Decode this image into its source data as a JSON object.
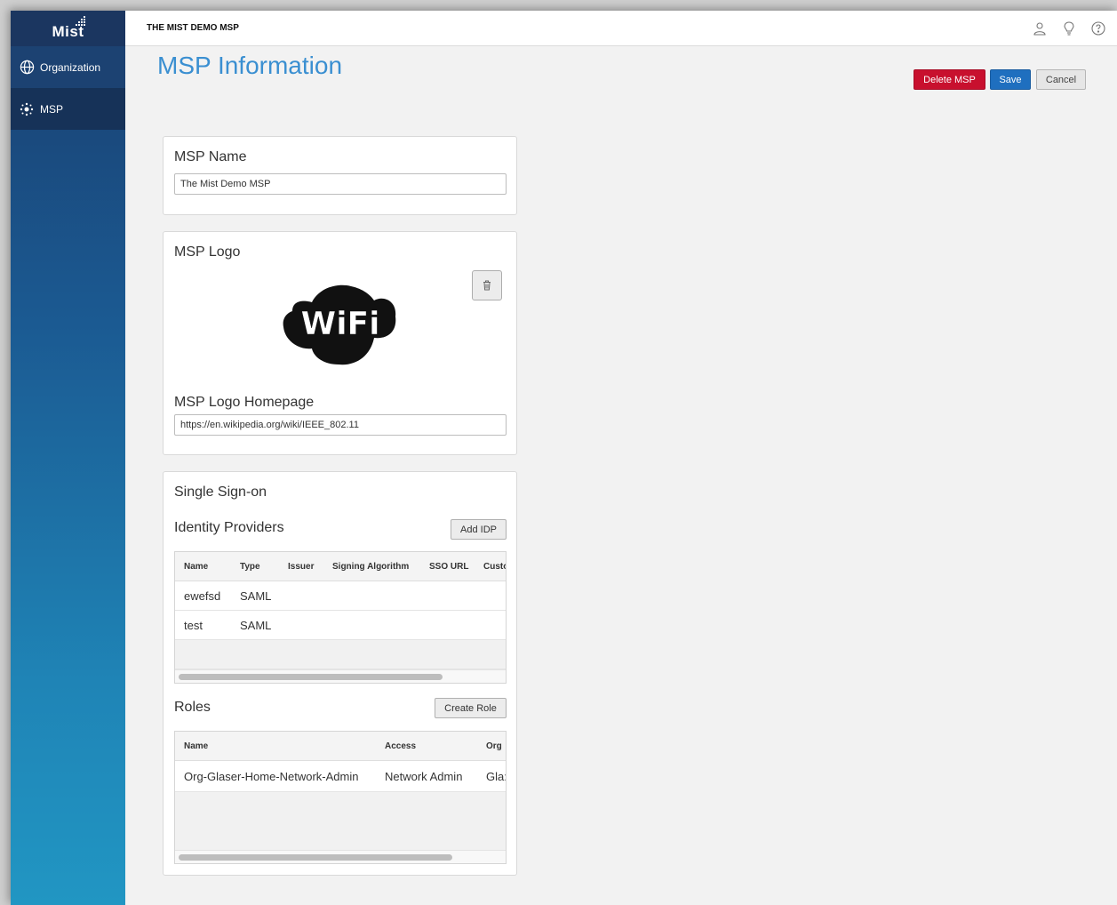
{
  "app": {
    "logo_text": "Mist",
    "msp_name_header": "THE MIST DEMO MSP"
  },
  "sidebar": {
    "items": [
      {
        "label": "Organization",
        "icon": "globe-icon"
      },
      {
        "label": "MSP",
        "icon": "msp-icon"
      }
    ]
  },
  "header_icons": [
    "user-icon",
    "lightbulb-icon",
    "help-icon"
  ],
  "page": {
    "title": "MSP Information",
    "buttons": {
      "delete": "Delete MSP",
      "save": "Save",
      "cancel": "Cancel"
    }
  },
  "msp_name": {
    "heading": "MSP Name",
    "value": "The Mist Demo MSP"
  },
  "msp_logo": {
    "heading": "MSP Logo",
    "logo_text": "WiFi",
    "homepage_heading": "MSP Logo Homepage",
    "homepage_value": "https://en.wikipedia.org/wiki/IEEE_802.11"
  },
  "sso": {
    "heading": "Single Sign-on",
    "idp": {
      "heading": "Identity Providers",
      "add_button": "Add IDP",
      "columns": [
        "Name",
        "Type",
        "Issuer",
        "Signing Algorithm",
        "SSO URL",
        "Custo"
      ],
      "rows": [
        {
          "name": "ewefsd",
          "type": "SAML"
        },
        {
          "name": "test",
          "type": "SAML"
        }
      ]
    },
    "roles": {
      "heading": "Roles",
      "create_button": "Create Role",
      "columns": [
        "Name",
        "Access",
        "Org"
      ],
      "rows": [
        {
          "name": "Org-Glaser-Home-Network-Admin",
          "access": "Network Admin",
          "org": "Gla:"
        }
      ]
    }
  },
  "colors": {
    "title_blue": "#3a8fd1",
    "delete_red": "#c8102e",
    "save_blue": "#1f6fbf",
    "sidebar_top": "#1a3f70",
    "sidebar_bottom": "#2196c3"
  }
}
